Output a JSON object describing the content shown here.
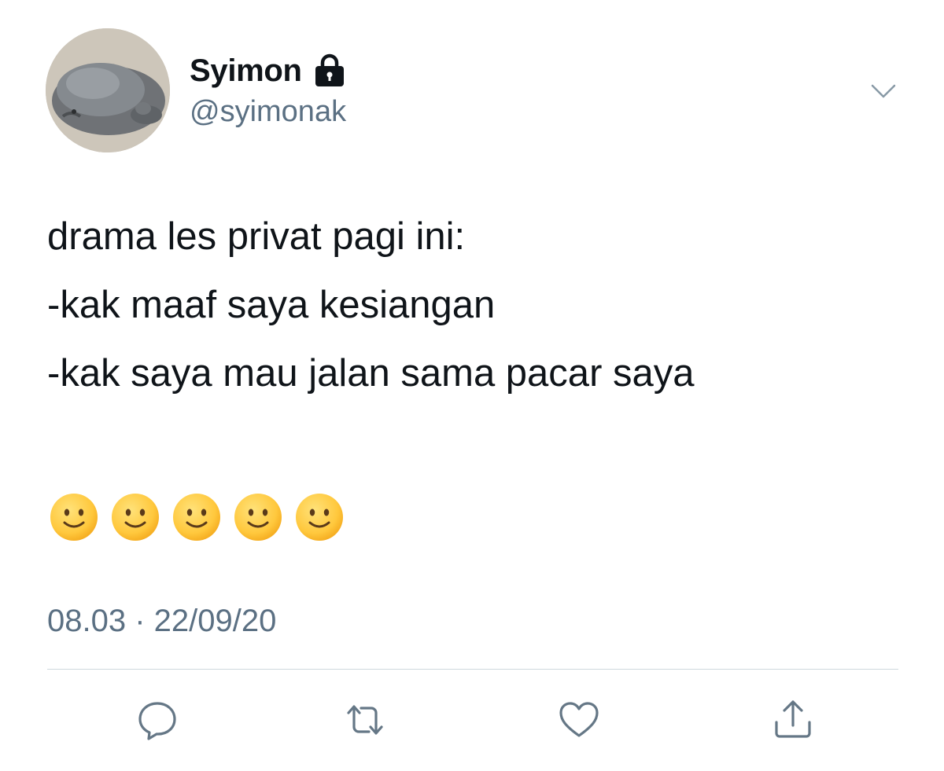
{
  "author": {
    "display_name": "Syimon",
    "handle": "@syimonak",
    "protected_icon": "lock-icon",
    "avatar_icon": "seal-plush-avatar"
  },
  "menu": {
    "icon": "chevron-down-icon"
  },
  "tweet": {
    "lines": [
      "drama les privat pagi ini:",
      "-kak maaf saya kesiangan",
      "-kak saya mau jalan sama pacar saya"
    ],
    "emojis": [
      "🙂",
      "🙂",
      "🙂",
      "🙂",
      "🙂"
    ],
    "timestamp": "08.03 · 22/09/20"
  },
  "actions": [
    {
      "name": "reply",
      "icon": "reply-icon"
    },
    {
      "name": "retweet",
      "icon": "retweet-icon"
    },
    {
      "name": "like",
      "icon": "heart-icon"
    },
    {
      "name": "share",
      "icon": "share-icon"
    }
  ],
  "colors": {
    "text": "#0f1419",
    "secondary": "#5b7083",
    "divider": "#cfd9de",
    "emoji_face": "#ffc83d"
  }
}
